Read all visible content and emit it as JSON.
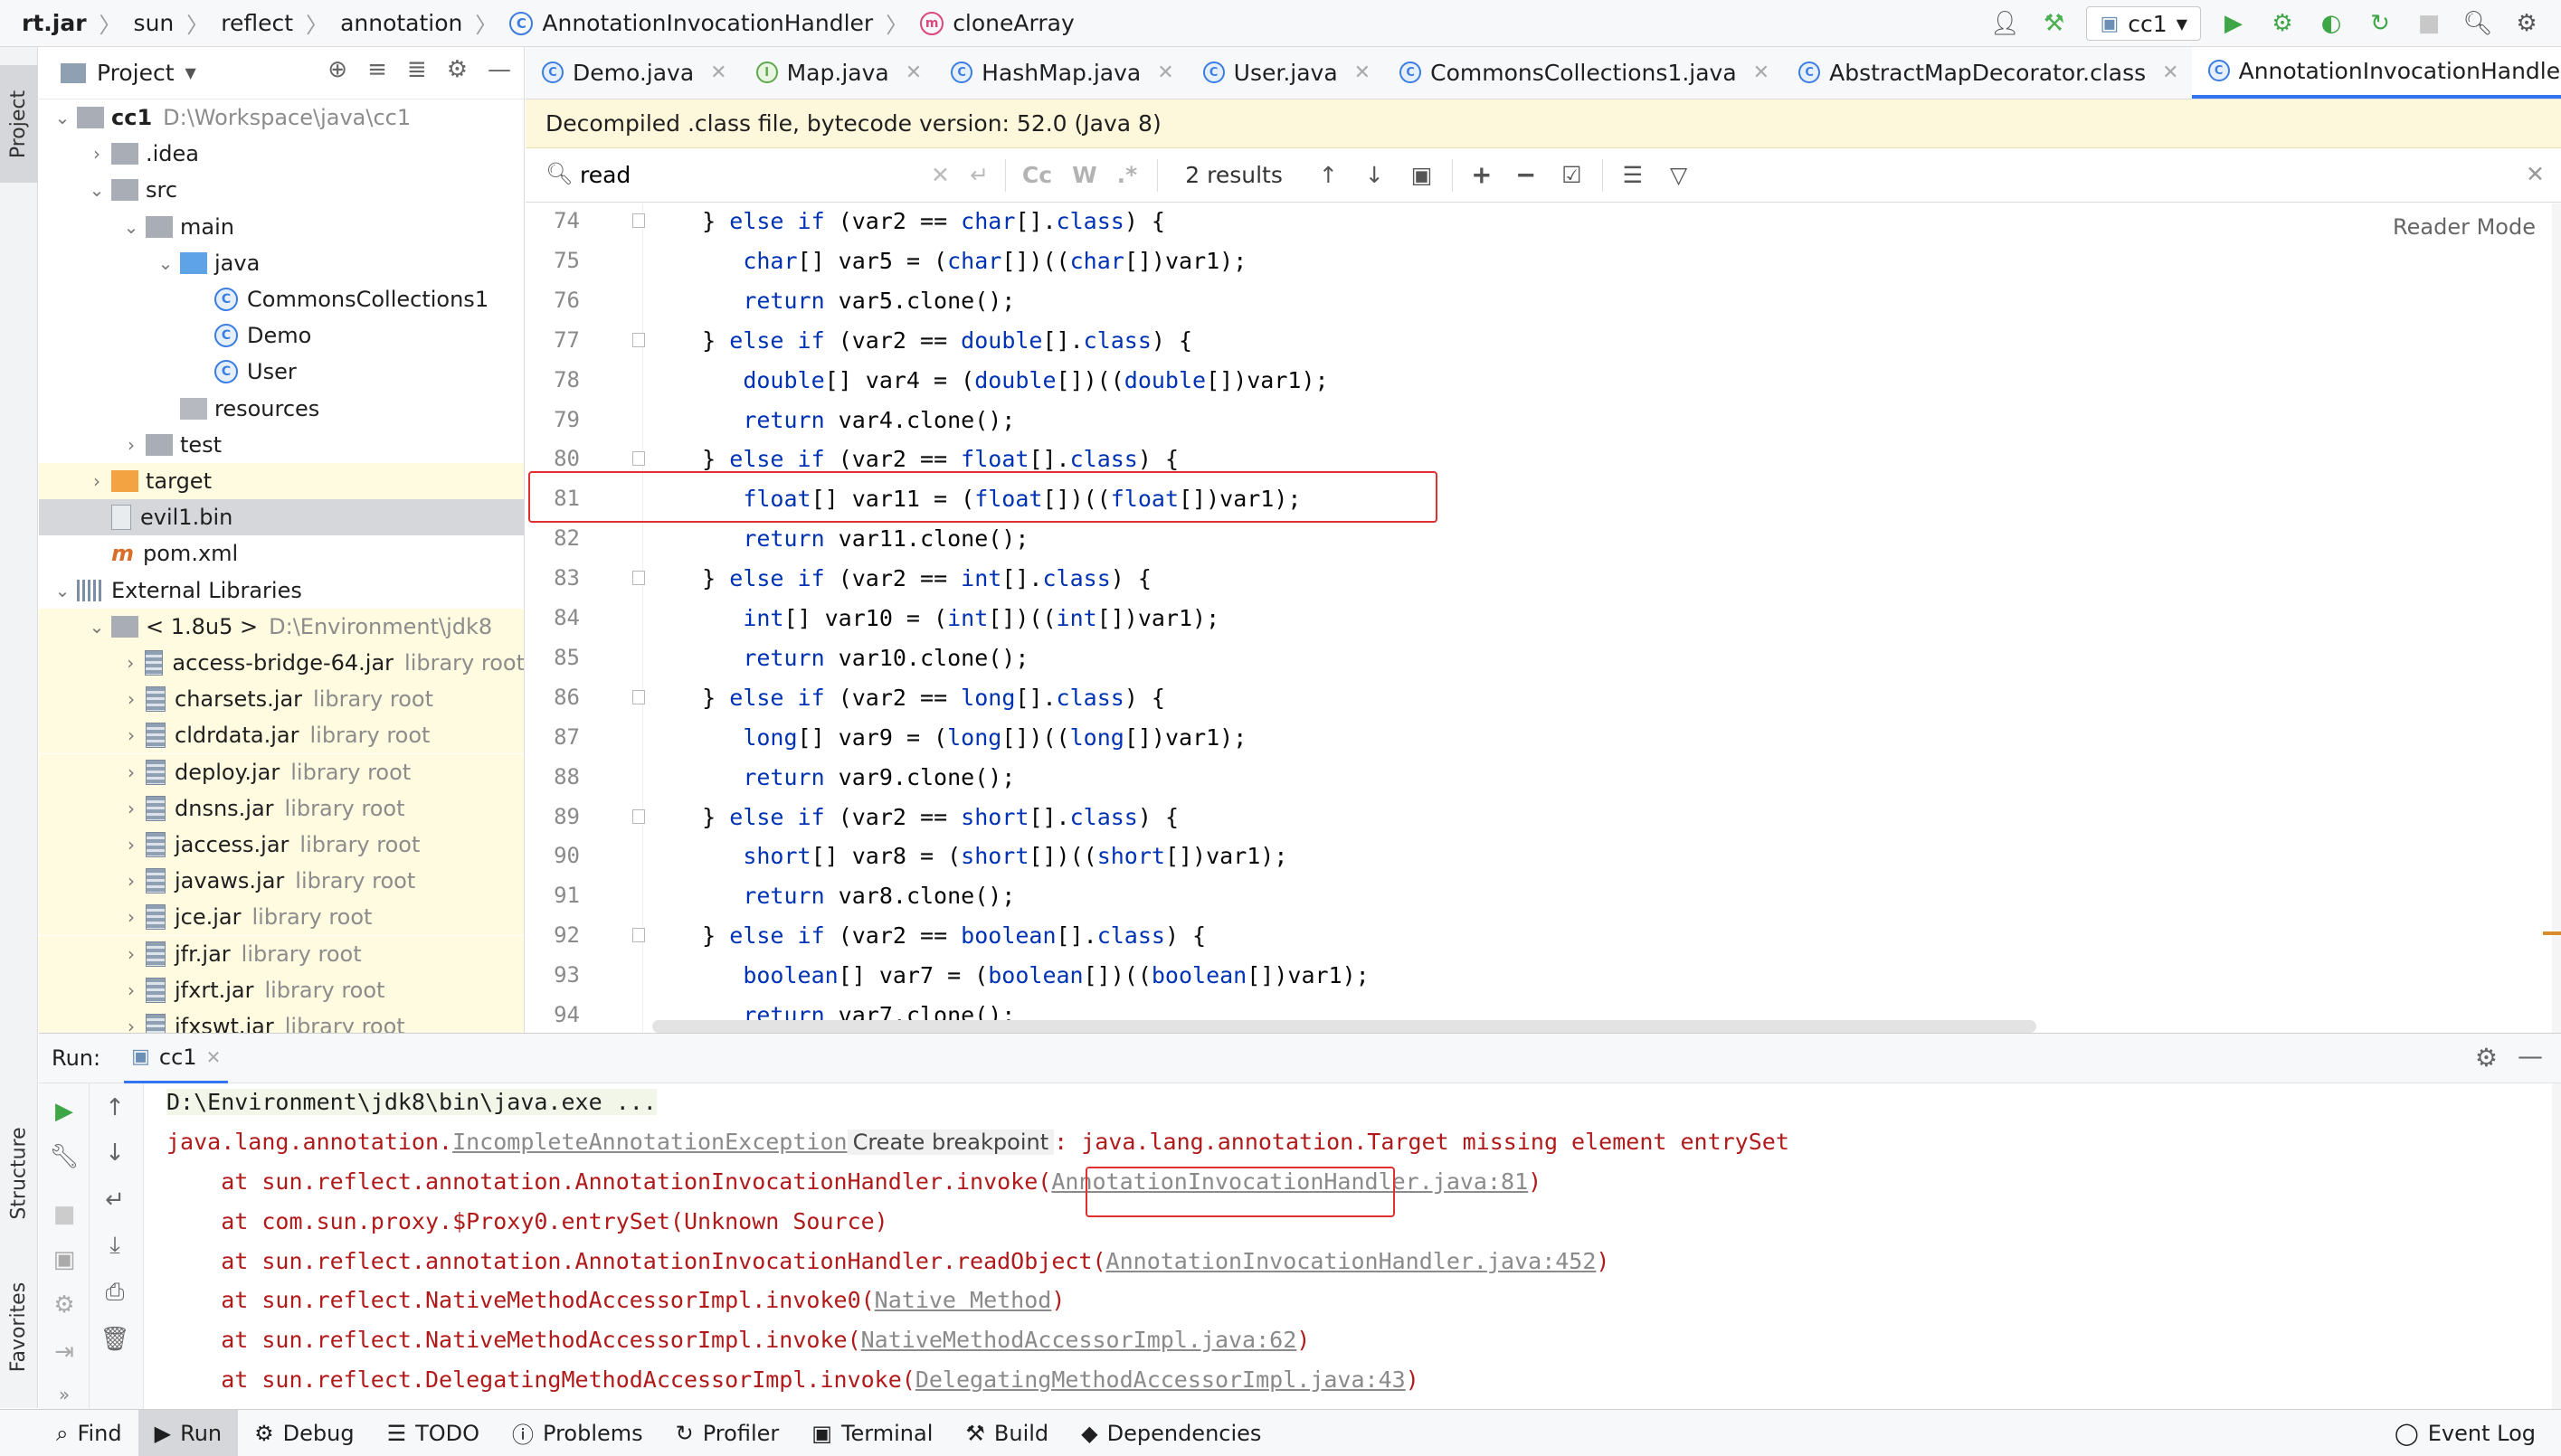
{
  "breadcrumb": [
    "rt.jar",
    "sun",
    "reflect",
    "annotation",
    "AnnotationInvocationHandler",
    "cloneArray"
  ],
  "toolbar": {
    "run_config": "cc1"
  },
  "side_tabs": {
    "project": "Project",
    "structure": "Structure",
    "favorites": "Favorites"
  },
  "project_panel": {
    "title": "Project",
    "tree": [
      {
        "label": "cc1",
        "extra": "D:\\Workspace\\java\\cc1",
        "bold": true
      },
      {
        "label": ".idea"
      },
      {
        "label": "src"
      },
      {
        "label": "main"
      },
      {
        "label": "java"
      },
      {
        "label": "CommonsCollections1"
      },
      {
        "label": "Demo"
      },
      {
        "label": "User"
      },
      {
        "label": "resources"
      },
      {
        "label": "test"
      },
      {
        "label": "target"
      },
      {
        "label": "evil1.bin"
      },
      {
        "label": "pom.xml"
      },
      {
        "label": "External Libraries"
      },
      {
        "label": "< 1.8u5 >",
        "extra": "D:\\Environment\\jdk8"
      },
      {
        "label": "access-bridge-64.jar",
        "extra": "library root"
      },
      {
        "label": "charsets.jar",
        "extra": "library root"
      },
      {
        "label": "cldrdata.jar",
        "extra": "library root"
      },
      {
        "label": "deploy.jar",
        "extra": "library root"
      },
      {
        "label": "dnsns.jar",
        "extra": "library root"
      },
      {
        "label": "jaccess.jar",
        "extra": "library root"
      },
      {
        "label": "javaws.jar",
        "extra": "library root"
      },
      {
        "label": "jce.jar",
        "extra": "library root"
      },
      {
        "label": "jfr.jar",
        "extra": "library root"
      },
      {
        "label": "jfxrt.jar",
        "extra": "library root"
      },
      {
        "label": "jfxswt.jar",
        "extra": "library root"
      }
    ]
  },
  "editor_tabs": [
    {
      "label": "Demo.java",
      "icon": "C"
    },
    {
      "label": "Map.java",
      "icon": "I"
    },
    {
      "label": "HashMap.java",
      "icon": "C"
    },
    {
      "label": "User.java",
      "icon": "C"
    },
    {
      "label": "CommonsCollections1.java",
      "icon": "C"
    },
    {
      "label": "AbstractMapDecorator.class",
      "icon": "C"
    },
    {
      "label": "AnnotationInvocationHandler.class",
      "icon": "C",
      "active": true
    }
  ],
  "banner": "Decompiled .class file, bytecode version: 52.0 (Java 8)",
  "search": {
    "value": "read",
    "results": "2 results",
    "case_label": "Cc",
    "word_label": "W",
    "regex_label": ".*"
  },
  "editor": {
    "reader_mode": "Reader Mode",
    "lines": [
      {
        "n": "74",
        "code": "   } else if (var2 == char[].class) {"
      },
      {
        "n": "75",
        "code": "      char[] var5 = (char[])((char[])var1);"
      },
      {
        "n": "76",
        "code": "      return var5.clone();"
      },
      {
        "n": "77",
        "code": "   } else if (var2 == double[].class) {"
      },
      {
        "n": "78",
        "code": "      double[] var4 = (double[])((double[])var1);"
      },
      {
        "n": "79",
        "code": "      return var4.clone();"
      },
      {
        "n": "80",
        "code": "   } else if (var2 == float[].class) {"
      },
      {
        "n": "81",
        "code": "      float[] var11 = (float[])((float[])var1);"
      },
      {
        "n": "82",
        "code": "      return var11.clone();"
      },
      {
        "n": "83",
        "code": "   } else if (var2 == int[].class) {"
      },
      {
        "n": "84",
        "code": "      int[] var10 = (int[])((int[])var1);"
      },
      {
        "n": "85",
        "code": "      return var10.clone();"
      },
      {
        "n": "86",
        "code": "   } else if (var2 == long[].class) {"
      },
      {
        "n": "87",
        "code": "      long[] var9 = (long[])((long[])var1);"
      },
      {
        "n": "88",
        "code": "      return var9.clone();"
      },
      {
        "n": "89",
        "code": "   } else if (var2 == short[].class) {"
      },
      {
        "n": "90",
        "code": "      short[] var8 = (short[])((short[])var1);"
      },
      {
        "n": "91",
        "code": "      return var8.clone();"
      },
      {
        "n": "92",
        "code": "   } else if (var2 == boolean[].class) {"
      },
      {
        "n": "93",
        "code": "      boolean[] var7 = (boolean[])((boolean[])var1);"
      },
      {
        "n": "94",
        "code": "      return var7.clone();"
      }
    ]
  },
  "run_panel": {
    "label": "Run:",
    "tab": "cc1",
    "command": "D:\\Environment\\jdk8\\bin\\java.exe ...",
    "exception_prefix": "java.lang.annotation.",
    "exception_link": "IncompleteAnnotationException",
    "breakpoint_tip": "Create breakpoint",
    "exception_suffix": ": java.lang.annotation.Target missing element entrySet",
    "stack": [
      {
        "text": "    at sun.reflect.annotation.AnnotationInvocationHandler.invoke(",
        "link": "AnnotationInvocationHandler.java:81",
        "end": ")"
      },
      {
        "text": "    at com.sun.proxy.$Proxy0.entrySet(Unknown Source)",
        "link": "",
        "end": ""
      },
      {
        "text": "    at sun.reflect.annotation.AnnotationInvocationHandler.readObject(",
        "link": "AnnotationInvocationHandler.java:452",
        "end": ")"
      },
      {
        "text": "    at sun.reflect.NativeMethodAccessorImpl.invoke0(",
        "link": "Native Method",
        "end": ")"
      },
      {
        "text": "    at sun.reflect.NativeMethodAccessorImpl.invoke(",
        "link": "NativeMethodAccessorImpl.java:62",
        "end": ")"
      },
      {
        "text": "    at sun.reflect.DelegatingMethodAccessorImpl.invoke(",
        "link": "DelegatingMethodAccessorImpl.java:43",
        "end": ")"
      }
    ]
  },
  "bottom_tabs": [
    "Find",
    "Run",
    "Debug",
    "TODO",
    "Problems",
    "Profiler",
    "Terminal",
    "Build",
    "Dependencies"
  ],
  "event_log": "Event Log",
  "keywords": [
    "char",
    "double",
    "float",
    "int",
    "long",
    "short",
    "boolean",
    "else",
    "if",
    "return",
    "class"
  ]
}
